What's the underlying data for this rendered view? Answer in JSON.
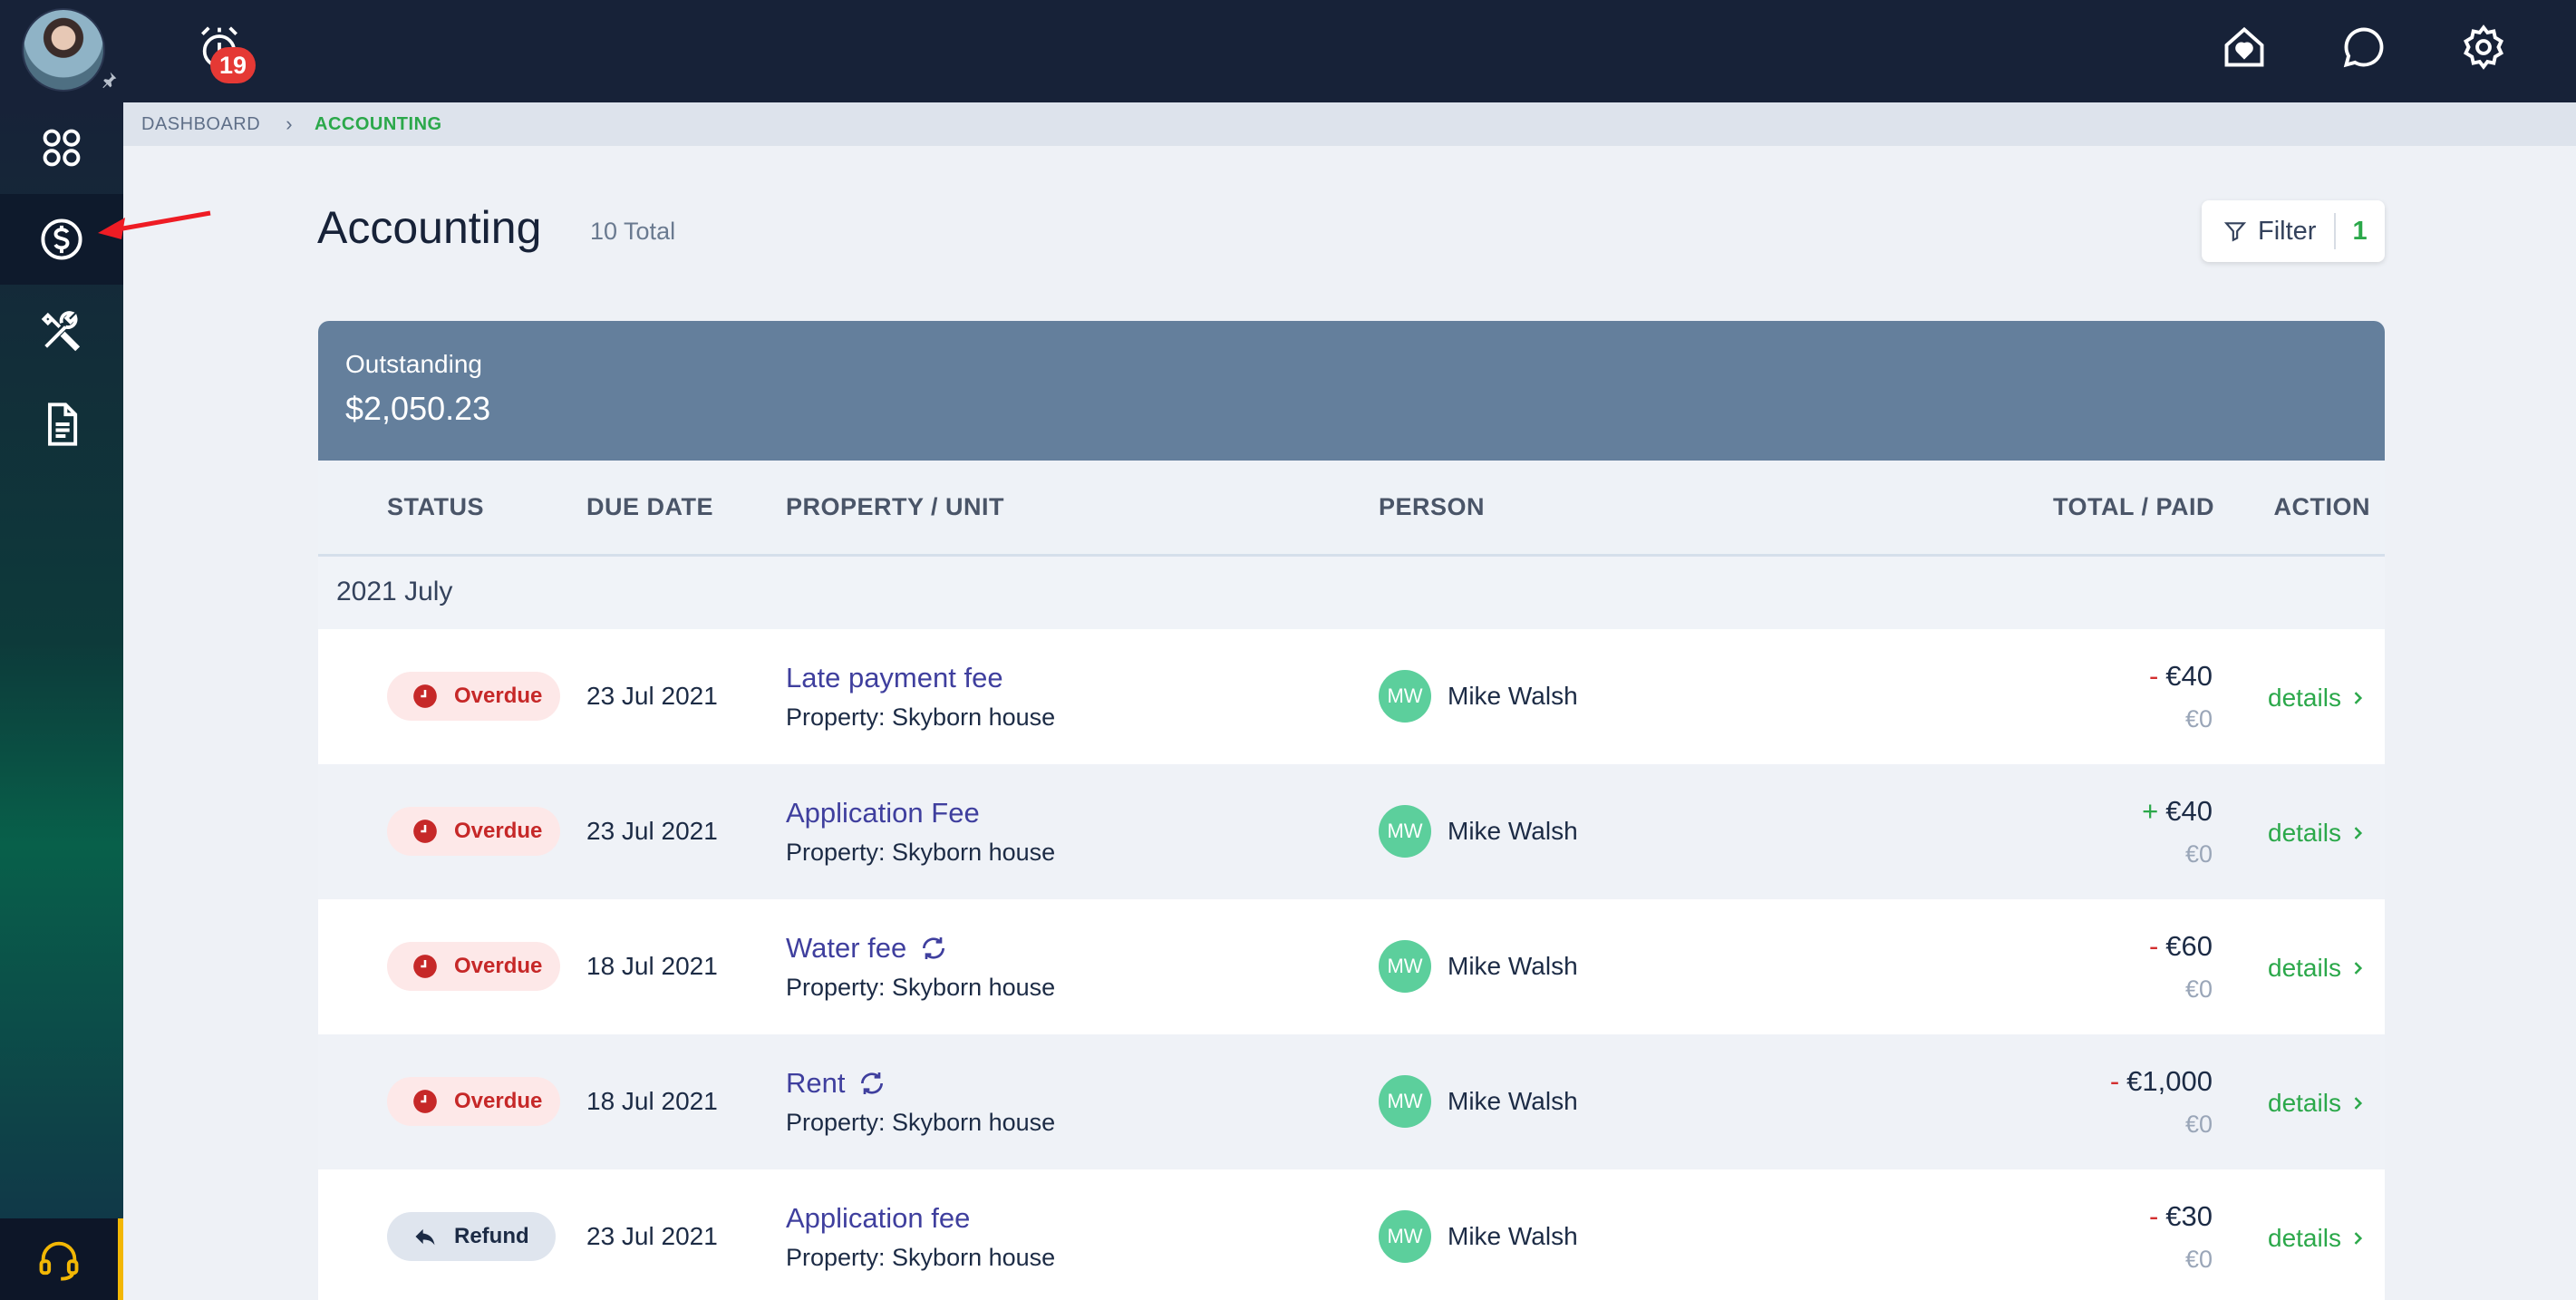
{
  "topbar": {
    "alarm_badge": "19",
    "icons": [
      "home-heart-icon",
      "chat-icon",
      "gear-icon"
    ]
  },
  "sidebar": {
    "items": [
      "dashboard-grid-icon",
      "accounting-dollar-icon",
      "tools-icon",
      "document-icon"
    ],
    "active": "accounting-dollar-icon",
    "support_icon": "headset-icon"
  },
  "breadcrumb": {
    "items": [
      "DASHBOARD",
      "ACCOUNTING"
    ]
  },
  "header": {
    "title": "Accounting",
    "total": "10 Total",
    "filter_label": "Filter",
    "filter_count": "1"
  },
  "summary": {
    "label": "Outstanding",
    "value": "$2,050.23"
  },
  "table": {
    "columns": [
      "STATUS",
      "DUE DATE",
      "PROPERTY / UNIT",
      "PERSON",
      "TOTAL / PAID",
      "ACTION"
    ],
    "group": "2021 July",
    "rows": [
      {
        "status": "Overdue",
        "due": "23 Jul 2021",
        "title": "Late payment fee",
        "recurring": false,
        "property": "Property: Skyborn house",
        "initials": "MW",
        "person": "Mike Walsh",
        "sign": "-",
        "total": "€40",
        "paid": "€0",
        "action": "details"
      },
      {
        "status": "Overdue",
        "due": "23 Jul 2021",
        "title": "Application Fee",
        "recurring": false,
        "property": "Property: Skyborn house",
        "initials": "MW",
        "person": "Mike Walsh",
        "sign": "+",
        "total": "€40",
        "paid": "€0",
        "action": "details"
      },
      {
        "status": "Overdue",
        "due": "18 Jul 2021",
        "title": "Water fee",
        "recurring": true,
        "property": "Property: Skyborn house",
        "initials": "MW",
        "person": "Mike Walsh",
        "sign": "-",
        "total": "€60",
        "paid": "€0",
        "action": "details"
      },
      {
        "status": "Overdue",
        "due": "18 Jul 2021",
        "title": "Rent",
        "recurring": true,
        "property": "Property: Skyborn house",
        "initials": "MW",
        "person": "Mike Walsh",
        "sign": "-",
        "total": "€1,000",
        "paid": "€0",
        "action": "details"
      },
      {
        "status": "Refund",
        "due": "23 Jul 2021",
        "title": "Application fee",
        "recurring": false,
        "property": "Property: Skyborn house",
        "initials": "MW",
        "person": "Mike Walsh",
        "sign": "-",
        "total": "€30",
        "paid": "€0",
        "action": "details"
      }
    ]
  },
  "colors": {
    "topbar": "#172238",
    "accent_green": "#2ba84a",
    "overdue_red": "#c62828",
    "summary_bg": "#647f9c",
    "link_purple": "#3f3f9e",
    "avatar_green": "#5ccf9c"
  }
}
